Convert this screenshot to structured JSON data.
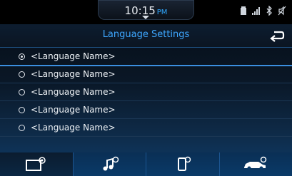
{
  "status": {
    "time": "10:15",
    "ampm": "PM",
    "icons": [
      "battery-icon",
      "signal-icon",
      "bluetooth-icon",
      "mute-icon"
    ]
  },
  "header": {
    "title": "Language Settings",
    "back_icon": "back-arrow-icon"
  },
  "languages": [
    {
      "label": "<Language Name>",
      "selected": true
    },
    {
      "label": "<Language Name>",
      "selected": false
    },
    {
      "label": "<Language Name>",
      "selected": false
    },
    {
      "label": "<Language Name>",
      "selected": false
    },
    {
      "label": "<Language Name>",
      "selected": false
    }
  ],
  "bottom_nav": [
    "settings-screen-icon",
    "music-settings-icon",
    "phone-settings-icon",
    "vehicle-settings-icon"
  ],
  "colors": {
    "accent": "#3ea7ff",
    "background": "#0a1726",
    "bottom_bar": "#0a3a68"
  }
}
